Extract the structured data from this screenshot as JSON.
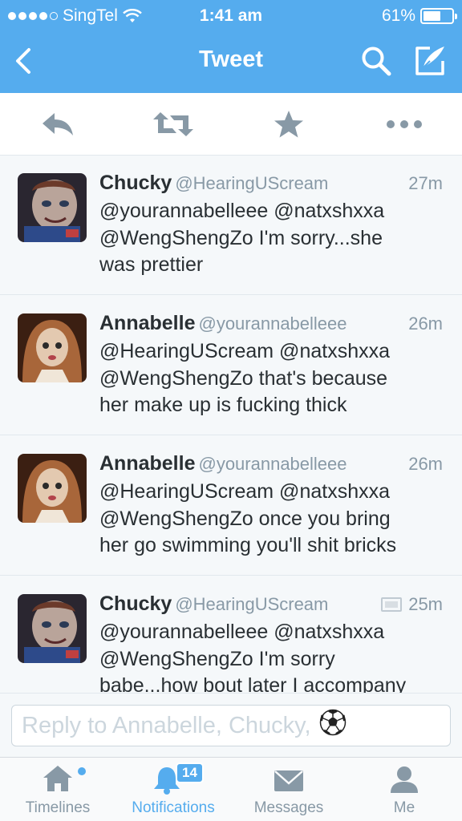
{
  "status_bar": {
    "carrier": "SingTel",
    "time": "1:41 am",
    "battery": "61%",
    "battery_level": 0.61
  },
  "nav": {
    "title": "Tweet",
    "back_icon": "chevron-left-icon",
    "search_icon": "search-icon",
    "compose_icon": "compose-icon"
  },
  "actions": [
    "reply-icon",
    "retweet-icon",
    "favorite-star-icon",
    "more-dots-icon"
  ],
  "tweets": [
    {
      "name": "Chucky",
      "handle": "@HearingUScream",
      "time": "27m",
      "text": "@yourannabelleee @natxshxxa\n@WengShengZo I'm sorry...she\nwas prettier",
      "has_media": false
    },
    {
      "name": "Annabelle",
      "handle": "@yourannabelleee",
      "time": "26m",
      "text": "@HearingUScream @natxshxxa\n@WengShengZo that's because\nher make up is fucking thick",
      "has_media": false
    },
    {
      "name": "Annabelle",
      "handle": "@yourannabelleee",
      "time": "26m",
      "text": "@HearingUScream @natxshxxa\n@WengShengZo once you bring\nher go swimming you'll shit bricks",
      "has_media": false
    },
    {
      "name": "Chucky",
      "handle": "@HearingUScream",
      "time": "25m",
      "text": "@yourannabelleee @natxshxxa\n@WengShengZo I'm sorry\nbabe...how bout later I accompany",
      "has_media": true
    }
  ],
  "reply": {
    "placeholder": "Reply to Annabelle, Chucky,",
    "emoji": "⚽"
  },
  "tabs": [
    {
      "label": "Timelines",
      "icon": "home-icon",
      "active": false,
      "dot": true
    },
    {
      "label": "Notifications",
      "icon": "bell-icon",
      "active": true,
      "badge": "14"
    },
    {
      "label": "Messages",
      "icon": "envelope-icon",
      "active": false
    },
    {
      "label": "Me",
      "icon": "person-icon",
      "active": false
    }
  ],
  "colors": {
    "brand": "#55acee",
    "text": "#292f33",
    "muted": "#8899a6",
    "icon": "#8899a6"
  }
}
